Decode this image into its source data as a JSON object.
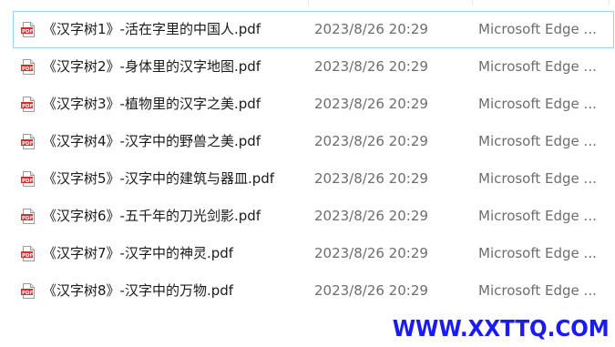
{
  "file_list": {
    "items": [
      {
        "name": "《汉字树1》-活在字里的中国人.pdf",
        "date": "2023/8/26 20:29",
        "type": "Microsoft Edge ...",
        "icon": "pdf-file-icon",
        "selected": true
      },
      {
        "name": "《汉字树2》-身体里的汉字地图.pdf",
        "date": "2023/8/26 20:29",
        "type": "Microsoft Edge ...",
        "icon": "pdf-file-icon",
        "selected": false
      },
      {
        "name": "《汉字树3》-植物里的汉字之美.pdf",
        "date": "2023/8/26 20:29",
        "type": "Microsoft Edge ...",
        "icon": "pdf-file-icon",
        "selected": false
      },
      {
        "name": "《汉字树4》-汉字中的野兽之美.pdf",
        "date": "2023/8/26 20:29",
        "type": "Microsoft Edge ...",
        "icon": "pdf-file-icon",
        "selected": false
      },
      {
        "name": "《汉字树5》-汉字中的建筑与器皿.pdf",
        "date": "2023/8/26 20:29",
        "type": "Microsoft Edge ...",
        "icon": "pdf-file-icon",
        "selected": false
      },
      {
        "name": "《汉字树6》-五千年的刀光剑影.pdf",
        "date": "2023/8/26 20:29",
        "type": "Microsoft Edge ...",
        "icon": "pdf-file-icon",
        "selected": false
      },
      {
        "name": "《汉字树7》-汉字中的神灵.pdf",
        "date": "2023/8/26 20:29",
        "type": "Microsoft Edge ...",
        "icon": "pdf-file-icon",
        "selected": false
      },
      {
        "name": "《汉字树8》-汉字中的万物.pdf",
        "date": "2023/8/26 20:29",
        "type": "Microsoft Edge ...",
        "icon": "pdf-file-icon",
        "selected": false
      }
    ]
  },
  "watermark": {
    "text": "WWW.XXTTQ.COM"
  },
  "colors": {
    "selection_border": "#99d1ff",
    "name_text": "#1a1a1a",
    "meta_text": "#6d6d6d",
    "pdf_red": "#d32f2f",
    "watermark": "#1a1aff"
  }
}
